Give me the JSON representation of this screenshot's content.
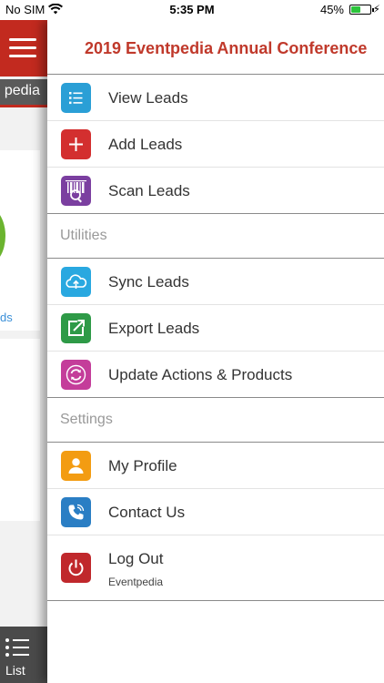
{
  "status_bar": {
    "carrier": "No SIM",
    "time": "5:35 PM",
    "battery_percent": "45%",
    "battery_level": 0.45,
    "battery_color": "#2bc43b"
  },
  "background_app": {
    "title_fragment": "pedia",
    "link_fragment": "ds",
    "tab_label": "List",
    "accent": "#c22a1f"
  },
  "drawer": {
    "title": "2019 Eventpedia Annual Conference",
    "title_color": "#c0392b",
    "groups": [
      {
        "items": [
          {
            "label": "View Leads",
            "icon": "list-icon",
            "color": "#2a9fd6"
          },
          {
            "label": "Add Leads",
            "icon": "plus-icon",
            "color": "#d32f2f"
          },
          {
            "label": "Scan Leads",
            "icon": "barcode-scan-icon",
            "color": "#7b3fa0"
          }
        ]
      },
      {
        "header": "Utilities",
        "items": [
          {
            "label": "Sync Leads",
            "icon": "cloud-sync-icon",
            "color": "#29a8e0"
          },
          {
            "label": "Export Leads",
            "icon": "export-icon",
            "color": "#2e9a47"
          },
          {
            "label": "Update Actions & Products",
            "icon": "refresh-icon",
            "color": "#c43d9a"
          }
        ]
      },
      {
        "header": "Settings",
        "items": [
          {
            "label": "My Profile",
            "icon": "user-icon",
            "color": "#f39c12"
          },
          {
            "label": "Contact Us",
            "icon": "phone-icon",
            "color": "#2a7ec4"
          },
          {
            "label": "Log Out",
            "sublabel": "Eventpedia",
            "icon": "power-icon",
            "color": "#c0282c"
          }
        ]
      }
    ]
  }
}
